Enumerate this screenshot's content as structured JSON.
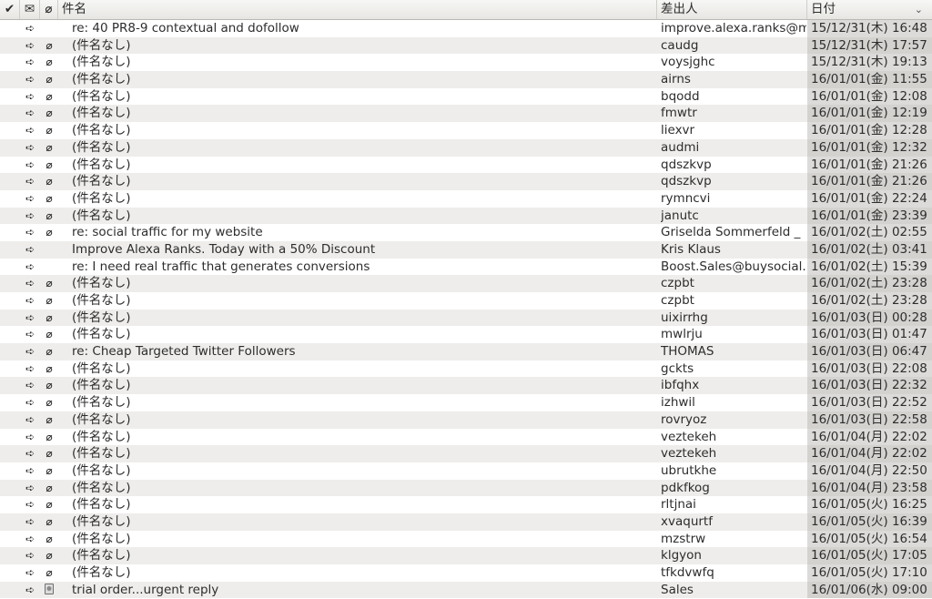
{
  "header": {
    "check_icon": "✔",
    "envelope_icon": "✉",
    "attachment_icon": "📎",
    "subject_label": "件名",
    "from_label": "差出人",
    "date_label": "日付",
    "sort_indicator": "⌄"
  },
  "messages": [
    {
      "subject": "re: 40 PR8-9 contextual and dofollow",
      "from": "improve.alexa.ranks@m",
      "date": "15/12/31(木) 16:48",
      "attachment": "none"
    },
    {
      "subject": "(件名なし)",
      "from": "caudg",
      "date": "15/12/31(木) 17:57",
      "attachment": "clip"
    },
    {
      "subject": "(件名なし)",
      "from": "voysjghc",
      "date": "15/12/31(木) 19:13",
      "attachment": "clip"
    },
    {
      "subject": "(件名なし)",
      "from": "airns",
      "date": "16/01/01(金) 11:55",
      "attachment": "clip"
    },
    {
      "subject": "(件名なし)",
      "from": "bqodd",
      "date": "16/01/01(金) 12:08",
      "attachment": "clip"
    },
    {
      "subject": "(件名なし)",
      "from": "fmwtr",
      "date": "16/01/01(金) 12:19",
      "attachment": "clip"
    },
    {
      "subject": "(件名なし)",
      "from": "liexvr",
      "date": "16/01/01(金) 12:28",
      "attachment": "clip"
    },
    {
      "subject": "(件名なし)",
      "from": "audmi",
      "date": "16/01/01(金) 12:32",
      "attachment": "clip"
    },
    {
      "subject": "(件名なし)",
      "from": "qdszkvp",
      "date": "16/01/01(金) 21:26",
      "attachment": "clip"
    },
    {
      "subject": "(件名なし)",
      "from": "qdszkvp",
      "date": "16/01/01(金) 21:26",
      "attachment": "clip"
    },
    {
      "subject": "(件名なし)",
      "from": "rymncvi",
      "date": "16/01/01(金) 22:24",
      "attachment": "clip"
    },
    {
      "subject": "(件名なし)",
      "from": "janutc",
      "date": "16/01/01(金) 23:39",
      "attachment": "clip"
    },
    {
      "subject": "re: social traffic for my website",
      "from": "Griselda Sommerfeld _",
      "date": "16/01/02(土) 02:55",
      "attachment": "clip"
    },
    {
      "subject": "Improve Alexa Ranks. Today with a 50% Discount",
      "from": "Kris Klaus",
      "date": "16/01/02(土) 03:41",
      "attachment": "none"
    },
    {
      "subject": "re: I need real traffic that generates conversions",
      "from": "Boost.Sales@buysocial.c",
      "date": "16/01/02(土) 15:39",
      "attachment": "none"
    },
    {
      "subject": "(件名なし)",
      "from": "czpbt",
      "date": "16/01/02(土) 23:28",
      "attachment": "clip"
    },
    {
      "subject": "(件名なし)",
      "from": "czpbt",
      "date": "16/01/02(土) 23:28",
      "attachment": "clip"
    },
    {
      "subject": "(件名なし)",
      "from": "uixirrhg",
      "date": "16/01/03(日) 00:28",
      "attachment": "clip"
    },
    {
      "subject": "(件名なし)",
      "from": "mwlrju",
      "date": "16/01/03(日) 01:47",
      "attachment": "clip"
    },
    {
      "subject": "re: Cheap Targeted Twitter Followers",
      "from": "THOMAS",
      "date": "16/01/03(日) 06:47",
      "attachment": "clip"
    },
    {
      "subject": "(件名なし)",
      "from": "gckts",
      "date": "16/01/03(日) 22:08",
      "attachment": "clip"
    },
    {
      "subject": "(件名なし)",
      "from": "ibfqhx",
      "date": "16/01/03(日) 22:32",
      "attachment": "clip"
    },
    {
      "subject": "(件名なし)",
      "from": "izhwil",
      "date": "16/01/03(日) 22:52",
      "attachment": "clip"
    },
    {
      "subject": "(件名なし)",
      "from": "rovryoz",
      "date": "16/01/03(日) 22:58",
      "attachment": "clip"
    },
    {
      "subject": "(件名なし)",
      "from": "veztekeh",
      "date": "16/01/04(月) 22:02",
      "attachment": "clip"
    },
    {
      "subject": "(件名なし)",
      "from": "veztekeh",
      "date": "16/01/04(月) 22:02",
      "attachment": "clip"
    },
    {
      "subject": "(件名なし)",
      "from": "ubrutkhe",
      "date": "16/01/04(月) 22:50",
      "attachment": "clip"
    },
    {
      "subject": "(件名なし)",
      "from": "pdkfkog",
      "date": "16/01/04(月) 23:58",
      "attachment": "clip"
    },
    {
      "subject": "(件名なし)",
      "from": "rltjnai",
      "date": "16/01/05(火) 16:25",
      "attachment": "clip"
    },
    {
      "subject": "(件名なし)",
      "from": "xvaqurtf",
      "date": "16/01/05(火) 16:39",
      "attachment": "clip"
    },
    {
      "subject": "(件名なし)",
      "from": "mzstrw",
      "date": "16/01/05(火) 16:54",
      "attachment": "clip"
    },
    {
      "subject": "(件名なし)",
      "from": "klgyon",
      "date": "16/01/05(火) 17:05",
      "attachment": "clip"
    },
    {
      "subject": "(件名なし)",
      "from": "tfkdvwfq",
      "date": "16/01/05(火) 17:10",
      "attachment": "clip"
    },
    {
      "subject": "trial order...urgent reply",
      "from": "Sales",
      "date": "16/01/06(水) 09:00",
      "attachment": "image"
    }
  ],
  "icons": {
    "forwarded": "forwarded-arrow-icon",
    "clip": "paperclip-icon",
    "image": "image-attachment-icon",
    "forward_glyph": "➪",
    "clip_glyph": "🄯"
  }
}
